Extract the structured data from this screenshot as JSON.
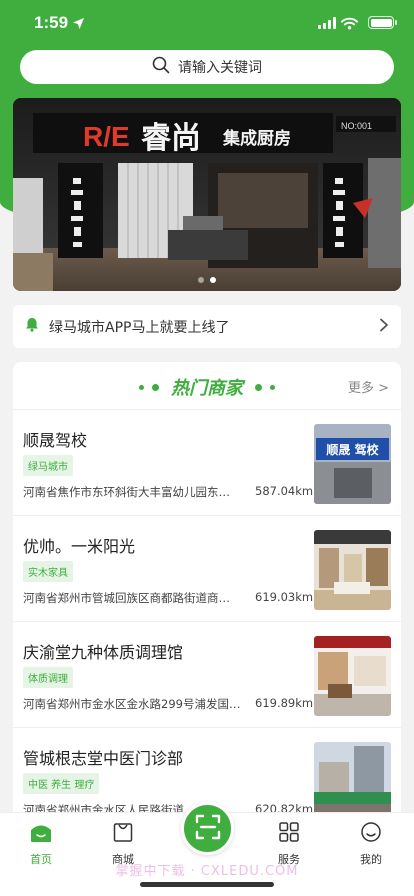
{
  "status": {
    "time": "1:59"
  },
  "search": {
    "placeholder": "请输入关键词"
  },
  "banner": {
    "sign_brand": "R/E",
    "sign_name": "睿尚",
    "sign_sub": "集成厨房",
    "sign_no": "NO:001",
    "slides": 2,
    "active_slide": 1
  },
  "notice": {
    "text": "绿马城市APP马上就要上线了"
  },
  "merchants": {
    "title": "热门商家",
    "more": "更多 >",
    "items": [
      {
        "name": "顺晟驾校",
        "tag": "绿马城市",
        "address": "河南省焦作市东环斜街大丰富幼儿园东…",
        "distance": "587.04km",
        "img_sign": "顺晟 驾校"
      },
      {
        "name": "优帅。一米阳光",
        "tag": "实木家具",
        "address": "河南省郑州市管城回族区商都路街道商…",
        "distance": "619.03km"
      },
      {
        "name": "庆渝堂九种体质调理馆",
        "tag": "体质调理",
        "address": "河南省郑州市金水区金水路299号浦发国…",
        "distance": "619.89km"
      },
      {
        "name": "管城根志堂中医门诊部",
        "tag": "中医 养生 理疗",
        "address": "河南省郑州市金水区人民路街道…",
        "distance": "620.82km"
      }
    ]
  },
  "tabbar": {
    "home": "首页",
    "mall": "商城",
    "service": "服务",
    "mine": "我的"
  },
  "watermark": "掌握中下载 · CXLEDU.COM",
  "colors": {
    "brand": "#3fae3f",
    "tag_bg": "#e5f4e5"
  }
}
